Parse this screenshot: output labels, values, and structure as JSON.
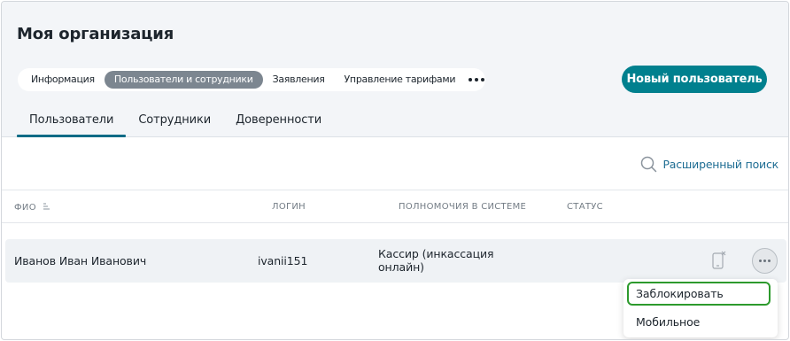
{
  "page": {
    "title": "Моя организация"
  },
  "top_tabs": [
    {
      "label": "Информация",
      "active": false
    },
    {
      "label": "Пользователи и сотрудники",
      "active": true
    },
    {
      "label": "Заявления",
      "active": false
    },
    {
      "label": "Управление тарифами",
      "active": false
    }
  ],
  "actions": {
    "new_user_label": "Новый пользователь"
  },
  "sub_tabs": [
    {
      "label": "Пользователи",
      "active": true
    },
    {
      "label": "Сотрудники",
      "active": false
    },
    {
      "label": "Доверенности",
      "active": false
    }
  ],
  "search": {
    "advanced_label": "Расширенный поиск",
    "icon": "search-icon"
  },
  "table": {
    "columns": [
      "ФИО",
      "ЛОГИН",
      "ПОЛНОМОЧИЯ В СИСТЕМЕ",
      "СТАТУС"
    ],
    "rows": [
      {
        "name": "Иванов Иван Иванович",
        "login": "ivanii151",
        "role_line1": "Кассир (инкассация",
        "role_line2": "онлайн)",
        "status": ""
      }
    ]
  },
  "row_menu": {
    "items": [
      {
        "label": "Заблокировать",
        "focused": true
      },
      {
        "label": "Мобильное приложение",
        "focused": false
      }
    ]
  },
  "colors": {
    "accent": "#00808e",
    "link": "#1e6d93",
    "active_tab_underline": "#0c6b86",
    "focus_outline": "#2d9a2d"
  }
}
